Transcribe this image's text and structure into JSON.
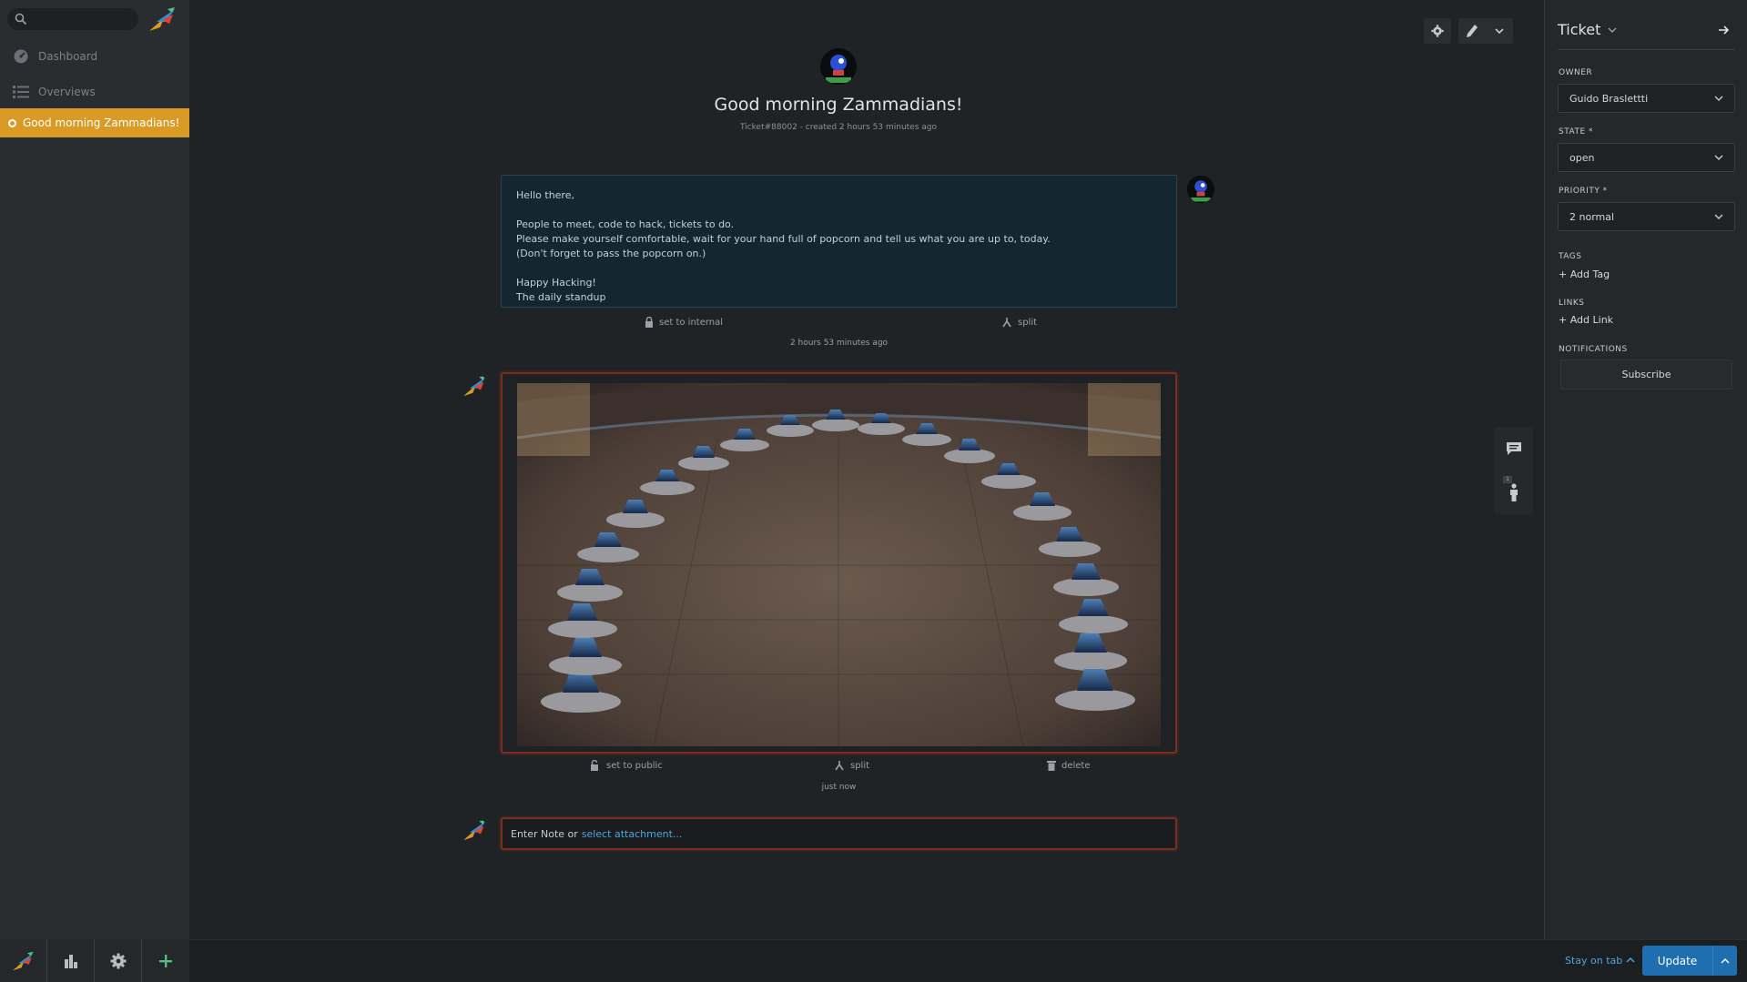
{
  "nav": {
    "search_placeholder": "",
    "items": [
      {
        "label": "Dashboard",
        "icon": "dashboard-icon"
      },
      {
        "label": "Overviews",
        "icon": "list-icon"
      }
    ],
    "open_task": "Good morning Zammadians!"
  },
  "ticket": {
    "title": "Good morning Zammadians!",
    "meta": "Ticket#88002 - created 2 hours 53 minutes ago"
  },
  "articles": [
    {
      "body": [
        "Hello there,",
        "People to meet, code to hack, tickets to do.\nPlease make yourself comfortable, wait for your hand full of popcorn and tell us what you are up to, today.\n(Don't forget to pass the popcorn on.)",
        "Happy Hacking!\nThe daily standup"
      ],
      "actions": {
        "internal": "set to internal",
        "split": "split"
      },
      "time": "2 hours 53 minutes ago"
    },
    {
      "actions": {
        "public": "set to public",
        "split": "split",
        "delete": "delete"
      },
      "time": "just now"
    }
  ],
  "note": {
    "placeholder": "Enter Note or",
    "link": "select attachment..."
  },
  "sidebar": {
    "title": "Ticket",
    "owner_label": "OWNER",
    "owner_value": "Guido Braslettti",
    "state_label": "STATE *",
    "state_value": "open",
    "priority_label": "PRIORITY *",
    "priority_value": "2 normal",
    "tags_label": "TAGS",
    "add_tag": "+ Add Tag",
    "links_label": "LINKS",
    "add_link": "+ Add Link",
    "notifications_label": "NOTIFICATIONS",
    "subscribe": "Subscribe"
  },
  "side_tabs": {
    "badge": "1"
  },
  "footer": {
    "stay_on_tab": "Stay on tab",
    "update": "Update"
  },
  "colors": {
    "accent": "#d99b26",
    "link": "#4aa7e0",
    "primary_button": "#1f6eaf",
    "highlight_border": "#7a2e20"
  }
}
